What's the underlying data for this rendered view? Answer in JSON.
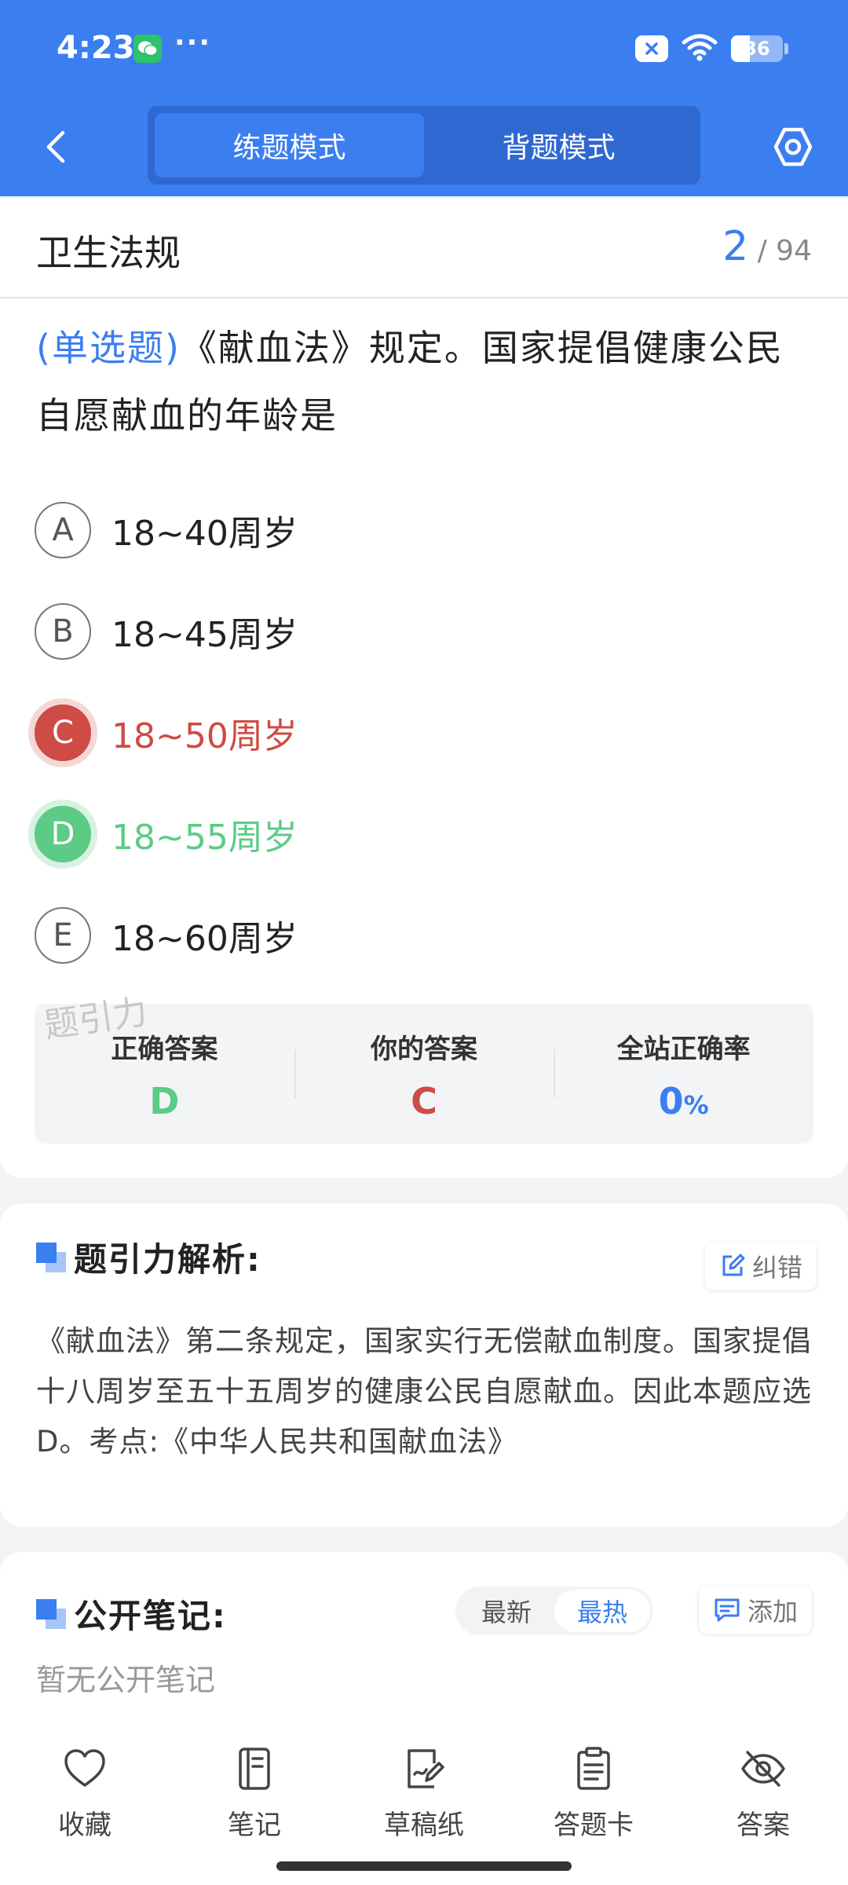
{
  "status_bar": {
    "time": "4:23",
    "dots": "···",
    "battery": "36"
  },
  "nav": {
    "modes": [
      {
        "label": "练题模式",
        "active": true
      },
      {
        "label": "背题模式",
        "active": false
      }
    ]
  },
  "subject": {
    "title": "卫生法规",
    "current": "2",
    "total": "/ 94"
  },
  "question": {
    "type": "(单选题)",
    "text": "《献血法》规定。国家提倡健康公民自愿献血的年龄是",
    "options": [
      {
        "letter": "A",
        "text": "18~40周岁",
        "state": "normal"
      },
      {
        "letter": "B",
        "text": "18~45周岁",
        "state": "normal"
      },
      {
        "letter": "C",
        "text": "18~50周岁",
        "state": "wrong"
      },
      {
        "letter": "D",
        "text": "18~55周岁",
        "state": "right"
      },
      {
        "letter": "E",
        "text": "18~60周岁",
        "state": "normal"
      }
    ]
  },
  "watermark": "题引力",
  "answer_summary": {
    "correct_label": "正确答案",
    "correct_value": "D",
    "yours_label": "你的答案",
    "yours_value": "C",
    "rate_label": "全站正确率",
    "rate_value": "0",
    "rate_unit": "%"
  },
  "analysis": {
    "title": "题引力解析:",
    "error_btn": "纠错",
    "text": "《献血法》第二条规定，国家实行无偿献血制度。国家提倡十八周岁至五十五周岁的健康公民自愿献血。因此本题应选D。考点:《中华人民共和国献血法》"
  },
  "notes": {
    "title": "公开笔记:",
    "sort": [
      {
        "label": "最新",
        "active": false
      },
      {
        "label": "最热",
        "active": true
      }
    ],
    "add_btn": "添加",
    "empty_text": "暂无公开笔记"
  },
  "bottom_bar": {
    "items": [
      {
        "label": "收藏",
        "icon": "heart-icon"
      },
      {
        "label": "笔记",
        "icon": "notebook-icon"
      },
      {
        "label": "草稿纸",
        "icon": "draft-paper-icon"
      },
      {
        "label": "答题卡",
        "icon": "answer-card-icon"
      },
      {
        "label": "答案",
        "icon": "eye-off-icon"
      }
    ]
  },
  "colors": {
    "primary": "#3b7ef0",
    "wrong": "#cf4b45",
    "right": "#5ccb85"
  }
}
